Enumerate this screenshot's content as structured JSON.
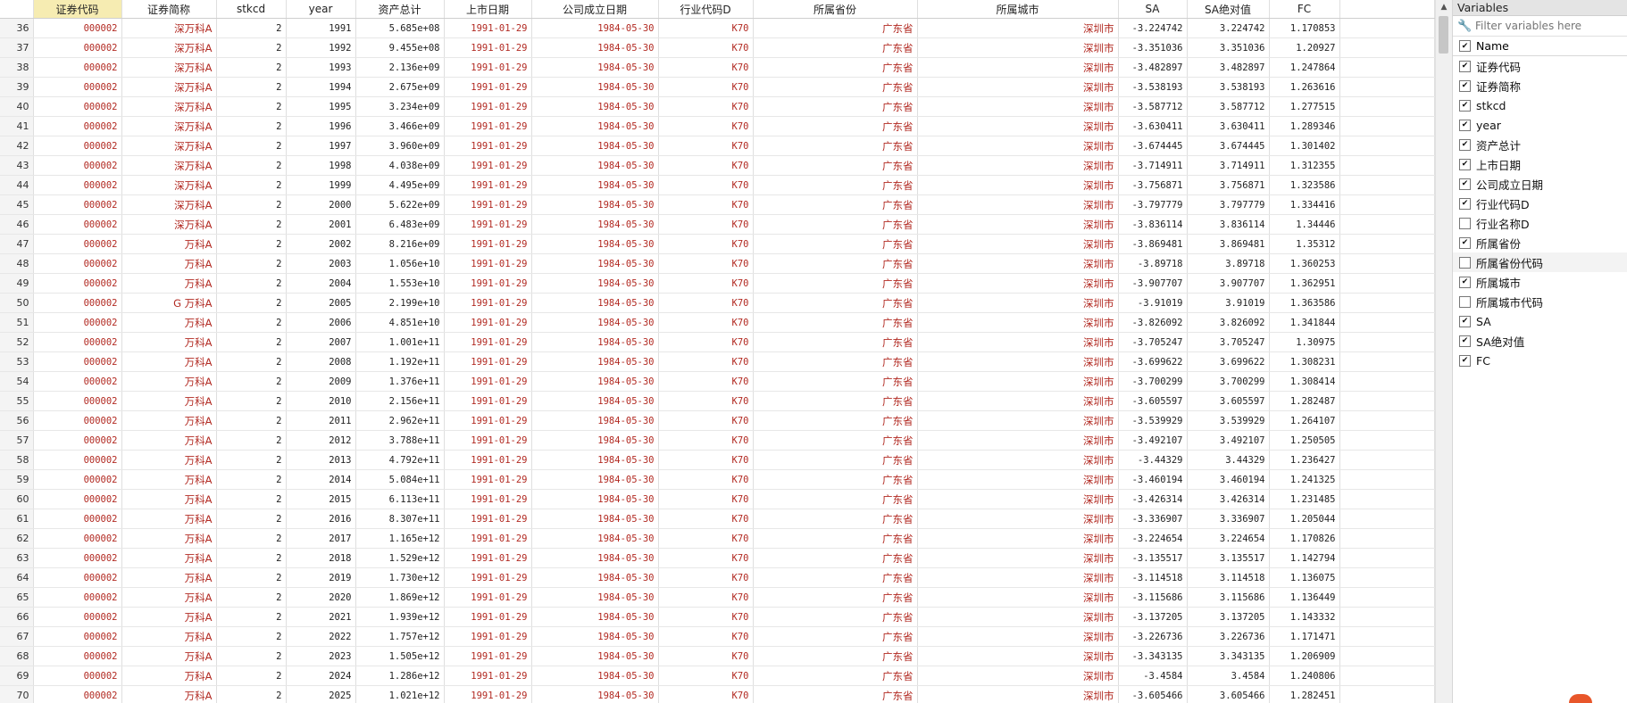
{
  "grid": {
    "columns": [
      "证券代码",
      "证券简称",
      "stkcd",
      "year",
      "资产总计",
      "上市日期",
      "公司成立日期",
      "行业代码D",
      "所属省份",
      "所属城市",
      "SA",
      "SA绝对值",
      "FC"
    ],
    "rows": [
      [
        "36",
        "000002",
        "深万科A",
        "2",
        "1991",
        "5.685e+08",
        "1991-01-29",
        "1984-05-30",
        "K70",
        "广东省",
        "深圳市",
        "-3.224742",
        "3.224742",
        "1.170853"
      ],
      [
        "37",
        "000002",
        "深万科A",
        "2",
        "1992",
        "9.455e+08",
        "1991-01-29",
        "1984-05-30",
        "K70",
        "广东省",
        "深圳市",
        "-3.351036",
        "3.351036",
        "1.20927"
      ],
      [
        "38",
        "000002",
        "深万科A",
        "2",
        "1993",
        "2.136e+09",
        "1991-01-29",
        "1984-05-30",
        "K70",
        "广东省",
        "深圳市",
        "-3.482897",
        "3.482897",
        "1.247864"
      ],
      [
        "39",
        "000002",
        "深万科A",
        "2",
        "1994",
        "2.675e+09",
        "1991-01-29",
        "1984-05-30",
        "K70",
        "广东省",
        "深圳市",
        "-3.538193",
        "3.538193",
        "1.263616"
      ],
      [
        "40",
        "000002",
        "深万科A",
        "2",
        "1995",
        "3.234e+09",
        "1991-01-29",
        "1984-05-30",
        "K70",
        "广东省",
        "深圳市",
        "-3.587712",
        "3.587712",
        "1.277515"
      ],
      [
        "41",
        "000002",
        "深万科A",
        "2",
        "1996",
        "3.466e+09",
        "1991-01-29",
        "1984-05-30",
        "K70",
        "广东省",
        "深圳市",
        "-3.630411",
        "3.630411",
        "1.289346"
      ],
      [
        "42",
        "000002",
        "深万科A",
        "2",
        "1997",
        "3.960e+09",
        "1991-01-29",
        "1984-05-30",
        "K70",
        "广东省",
        "深圳市",
        "-3.674445",
        "3.674445",
        "1.301402"
      ],
      [
        "43",
        "000002",
        "深万科A",
        "2",
        "1998",
        "4.038e+09",
        "1991-01-29",
        "1984-05-30",
        "K70",
        "广东省",
        "深圳市",
        "-3.714911",
        "3.714911",
        "1.312355"
      ],
      [
        "44",
        "000002",
        "深万科A",
        "2",
        "1999",
        "4.495e+09",
        "1991-01-29",
        "1984-05-30",
        "K70",
        "广东省",
        "深圳市",
        "-3.756871",
        "3.756871",
        "1.323586"
      ],
      [
        "45",
        "000002",
        "深万科A",
        "2",
        "2000",
        "5.622e+09",
        "1991-01-29",
        "1984-05-30",
        "K70",
        "广东省",
        "深圳市",
        "-3.797779",
        "3.797779",
        "1.334416"
      ],
      [
        "46",
        "000002",
        "深万科A",
        "2",
        "2001",
        "6.483e+09",
        "1991-01-29",
        "1984-05-30",
        "K70",
        "广东省",
        "深圳市",
        "-3.836114",
        "3.836114",
        "1.34446"
      ],
      [
        "47",
        "000002",
        "万科A",
        "2",
        "2002",
        "8.216e+09",
        "1991-01-29",
        "1984-05-30",
        "K70",
        "广东省",
        "深圳市",
        "-3.869481",
        "3.869481",
        "1.35312"
      ],
      [
        "48",
        "000002",
        "万科A",
        "2",
        "2003",
        "1.056e+10",
        "1991-01-29",
        "1984-05-30",
        "K70",
        "广东省",
        "深圳市",
        "-3.89718",
        "3.89718",
        "1.360253"
      ],
      [
        "49",
        "000002",
        "万科A",
        "2",
        "2004",
        "1.553e+10",
        "1991-01-29",
        "1984-05-30",
        "K70",
        "广东省",
        "深圳市",
        "-3.907707",
        "3.907707",
        "1.362951"
      ],
      [
        "50",
        "000002",
        "G 万科A",
        "2",
        "2005",
        "2.199e+10",
        "1991-01-29",
        "1984-05-30",
        "K70",
        "广东省",
        "深圳市",
        "-3.91019",
        "3.91019",
        "1.363586"
      ],
      [
        "51",
        "000002",
        "万科A",
        "2",
        "2006",
        "4.851e+10",
        "1991-01-29",
        "1984-05-30",
        "K70",
        "广东省",
        "深圳市",
        "-3.826092",
        "3.826092",
        "1.341844"
      ],
      [
        "52",
        "000002",
        "万科A",
        "2",
        "2007",
        "1.001e+11",
        "1991-01-29",
        "1984-05-30",
        "K70",
        "广东省",
        "深圳市",
        "-3.705247",
        "3.705247",
        "1.30975"
      ],
      [
        "53",
        "000002",
        "万科A",
        "2",
        "2008",
        "1.192e+11",
        "1991-01-29",
        "1984-05-30",
        "K70",
        "广东省",
        "深圳市",
        "-3.699622",
        "3.699622",
        "1.308231"
      ],
      [
        "54",
        "000002",
        "万科A",
        "2",
        "2009",
        "1.376e+11",
        "1991-01-29",
        "1984-05-30",
        "K70",
        "广东省",
        "深圳市",
        "-3.700299",
        "3.700299",
        "1.308414"
      ],
      [
        "55",
        "000002",
        "万科A",
        "2",
        "2010",
        "2.156e+11",
        "1991-01-29",
        "1984-05-30",
        "K70",
        "广东省",
        "深圳市",
        "-3.605597",
        "3.605597",
        "1.282487"
      ],
      [
        "56",
        "000002",
        "万科A",
        "2",
        "2011",
        "2.962e+11",
        "1991-01-29",
        "1984-05-30",
        "K70",
        "广东省",
        "深圳市",
        "-3.539929",
        "3.539929",
        "1.264107"
      ],
      [
        "57",
        "000002",
        "万科A",
        "2",
        "2012",
        "3.788e+11",
        "1991-01-29",
        "1984-05-30",
        "K70",
        "广东省",
        "深圳市",
        "-3.492107",
        "3.492107",
        "1.250505"
      ],
      [
        "58",
        "000002",
        "万科A",
        "2",
        "2013",
        "4.792e+11",
        "1991-01-29",
        "1984-05-30",
        "K70",
        "广东省",
        "深圳市",
        "-3.44329",
        "3.44329",
        "1.236427"
      ],
      [
        "59",
        "000002",
        "万科A",
        "2",
        "2014",
        "5.084e+11",
        "1991-01-29",
        "1984-05-30",
        "K70",
        "广东省",
        "深圳市",
        "-3.460194",
        "3.460194",
        "1.241325"
      ],
      [
        "60",
        "000002",
        "万科A",
        "2",
        "2015",
        "6.113e+11",
        "1991-01-29",
        "1984-05-30",
        "K70",
        "广东省",
        "深圳市",
        "-3.426314",
        "3.426314",
        "1.231485"
      ],
      [
        "61",
        "000002",
        "万科A",
        "2",
        "2016",
        "8.307e+11",
        "1991-01-29",
        "1984-05-30",
        "K70",
        "广东省",
        "深圳市",
        "-3.336907",
        "3.336907",
        "1.205044"
      ],
      [
        "62",
        "000002",
        "万科A",
        "2",
        "2017",
        "1.165e+12",
        "1991-01-29",
        "1984-05-30",
        "K70",
        "广东省",
        "深圳市",
        "-3.224654",
        "3.224654",
        "1.170826"
      ],
      [
        "63",
        "000002",
        "万科A",
        "2",
        "2018",
        "1.529e+12",
        "1991-01-29",
        "1984-05-30",
        "K70",
        "广东省",
        "深圳市",
        "-3.135517",
        "3.135517",
        "1.142794"
      ],
      [
        "64",
        "000002",
        "万科A",
        "2",
        "2019",
        "1.730e+12",
        "1991-01-29",
        "1984-05-30",
        "K70",
        "广东省",
        "深圳市",
        "-3.114518",
        "3.114518",
        "1.136075"
      ],
      [
        "65",
        "000002",
        "万科A",
        "2",
        "2020",
        "1.869e+12",
        "1991-01-29",
        "1984-05-30",
        "K70",
        "广东省",
        "深圳市",
        "-3.115686",
        "3.115686",
        "1.136449"
      ],
      [
        "66",
        "000002",
        "万科A",
        "2",
        "2021",
        "1.939e+12",
        "1991-01-29",
        "1984-05-30",
        "K70",
        "广东省",
        "深圳市",
        "-3.137205",
        "3.137205",
        "1.143332"
      ],
      [
        "67",
        "000002",
        "万科A",
        "2",
        "2022",
        "1.757e+12",
        "1991-01-29",
        "1984-05-30",
        "K70",
        "广东省",
        "深圳市",
        "-3.226736",
        "3.226736",
        "1.171471"
      ],
      [
        "68",
        "000002",
        "万科A",
        "2",
        "2023",
        "1.505e+12",
        "1991-01-29",
        "1984-05-30",
        "K70",
        "广东省",
        "深圳市",
        "-3.343135",
        "3.343135",
        "1.206909"
      ],
      [
        "69",
        "000002",
        "万科A",
        "2",
        "2024",
        "1.286e+12",
        "1991-01-29",
        "1984-05-30",
        "K70",
        "广东省",
        "深圳市",
        "-3.4584",
        "3.4584",
        "1.240806"
      ],
      [
        "70",
        "000002",
        "万科A",
        "2",
        "2025",
        "1.021e+12",
        "1991-01-29",
        "1984-05-30",
        "K70",
        "广东省",
        "深圳市",
        "-3.605466",
        "3.605466",
        "1.282451"
      ]
    ]
  },
  "vars": {
    "title": "Variables",
    "filter_placeholder": "Filter variables here",
    "name_header": "Name",
    "items": [
      {
        "label": "证券代码",
        "checked": true
      },
      {
        "label": "证券简称",
        "checked": true
      },
      {
        "label": "stkcd",
        "checked": true
      },
      {
        "label": "year",
        "checked": true
      },
      {
        "label": "资产总计",
        "checked": true
      },
      {
        "label": "上市日期",
        "checked": true
      },
      {
        "label": "公司成立日期",
        "checked": true
      },
      {
        "label": "行业代码D",
        "checked": true
      },
      {
        "label": "行业名称D",
        "checked": false
      },
      {
        "label": "所属省份",
        "checked": true
      },
      {
        "label": "所属省份代码",
        "checked": false
      },
      {
        "label": "所属城市",
        "checked": true
      },
      {
        "label": "所属城市代码",
        "checked": false
      },
      {
        "label": "SA",
        "checked": true
      },
      {
        "label": "SA绝对值",
        "checked": true
      },
      {
        "label": "FC",
        "checked": true
      }
    ]
  },
  "icons": {
    "filter": "wrench-icon",
    "scroll_up": "arrow-up-icon"
  },
  "colors": {
    "string_value": "#b22a22",
    "selected_header": "#f6ecb2"
  }
}
